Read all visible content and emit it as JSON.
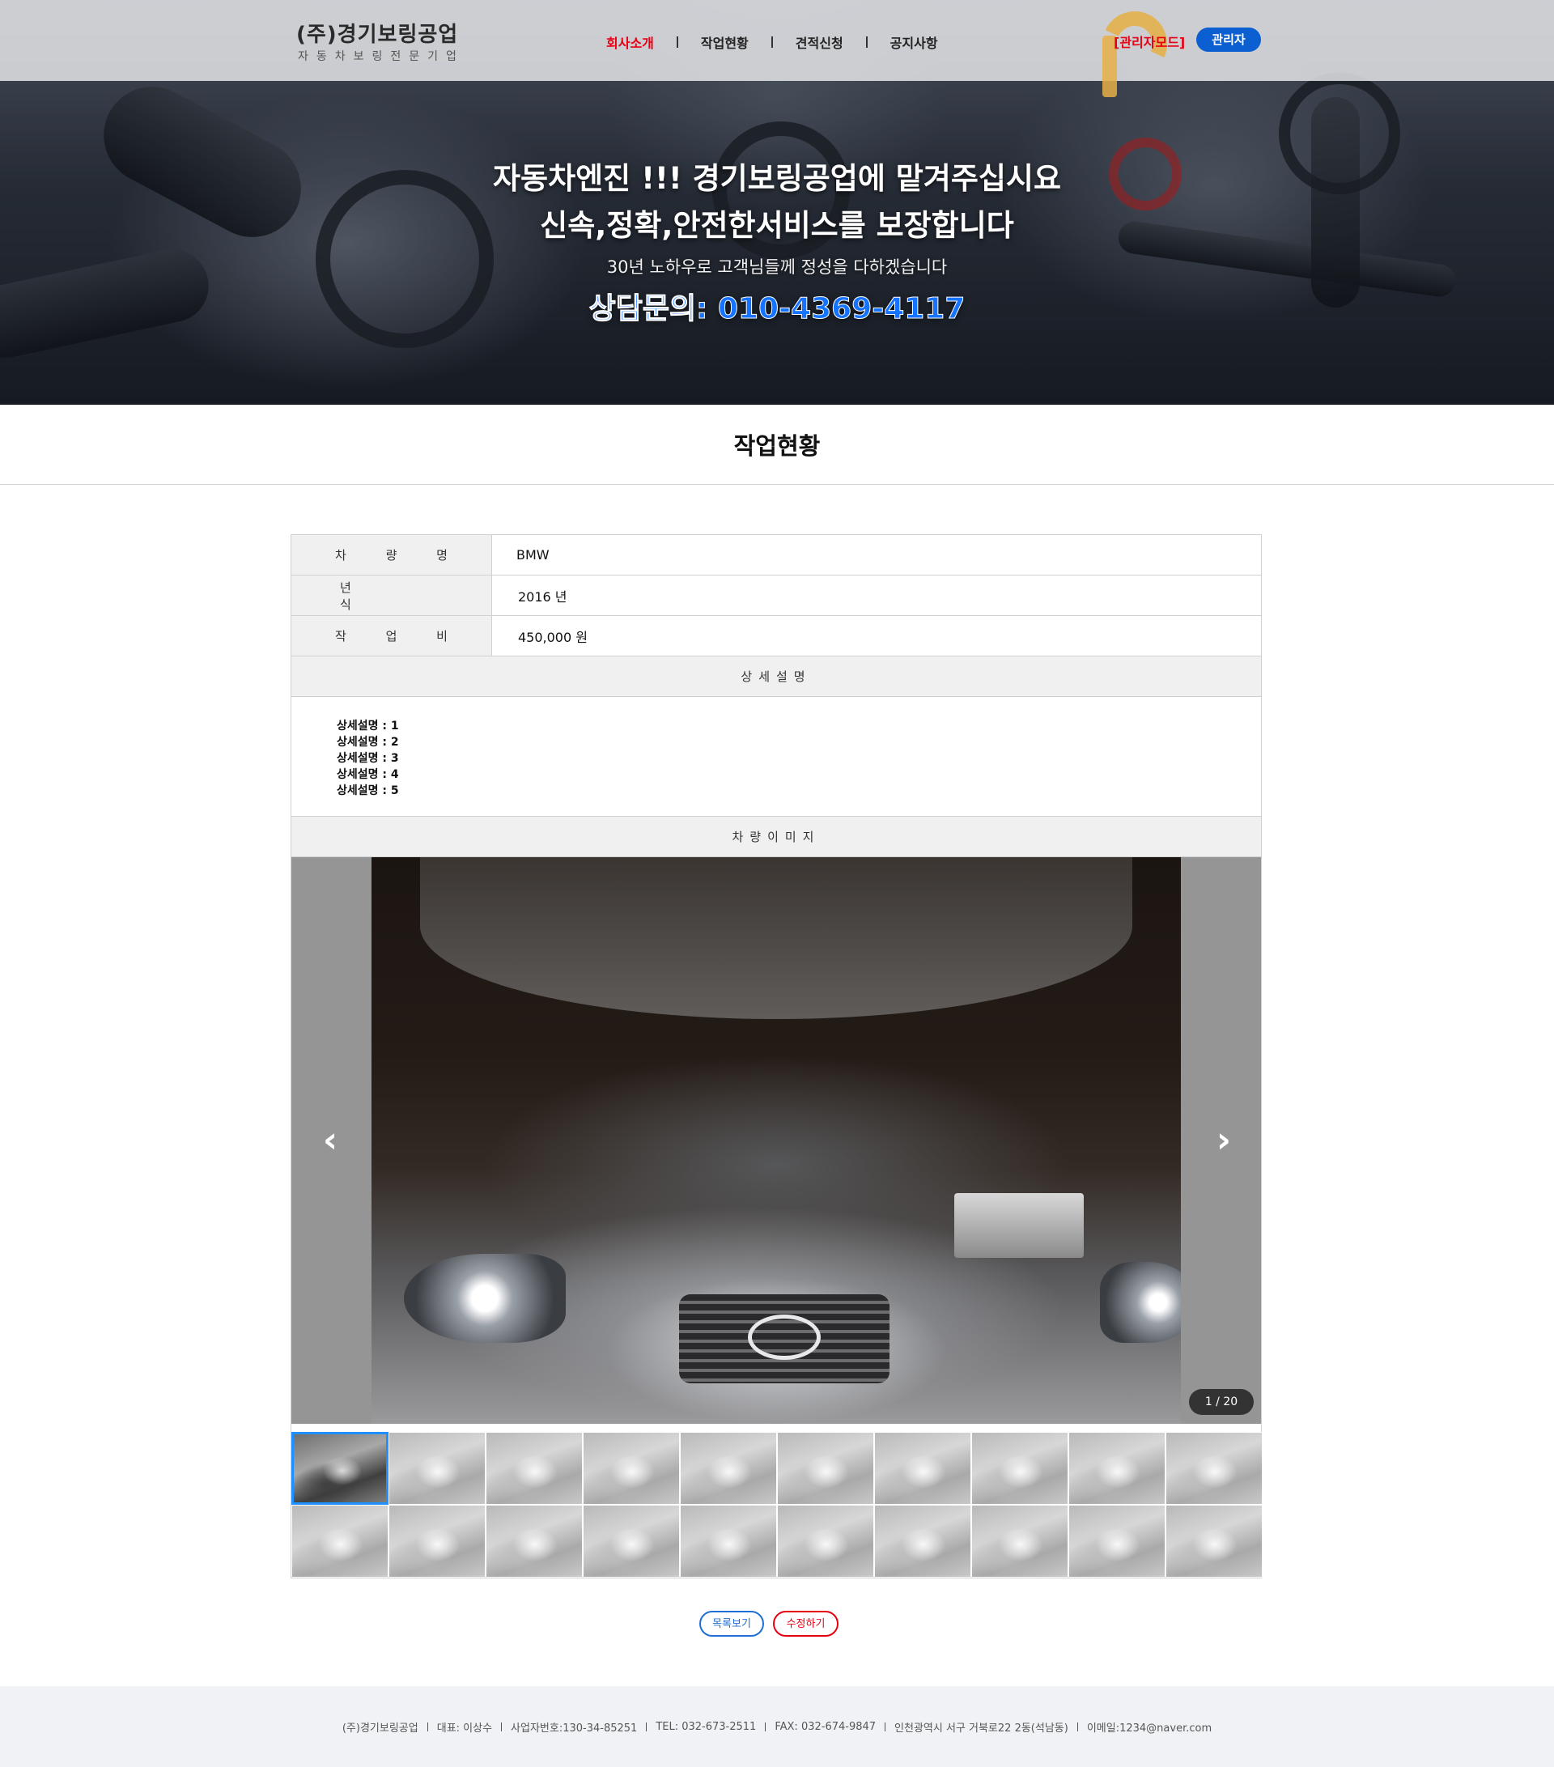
{
  "header": {
    "logo_title": "(주)경기보링공업",
    "logo_sub": "자동차보링전문기업",
    "nav": [
      "회사소개",
      "작업현황",
      "견적신청",
      "공지사항"
    ],
    "admin_mode": "[관리자모드]",
    "admin_button": "관리자"
  },
  "hero": {
    "line1": "자동차엔진 !!! 경기보링공업에 맡겨주십시요",
    "line2": "신속,정확,안전한서비스를 보장합니다",
    "line3": "30년 노하우로 고객님들께 정성을 다하겠습니다",
    "line4": "상담문의: 010-4369-4117"
  },
  "page_title": "작업현황",
  "info": {
    "car_label": "차 량 명",
    "car_value": "BMW",
    "year_label": "년 식",
    "year_value": "2016 년",
    "cost_label": "작 업 비",
    "cost_value": "450,000 원",
    "desc_header": "상세설명",
    "desc_lines": [
      "상세설명 : 1",
      "상세설명 : 2",
      "상세설명 : 3",
      "상세설명 : 4",
      "상세설명 : 5"
    ],
    "image_header": "차량이미지"
  },
  "slider": {
    "prev_icon": "chevron-left-icon",
    "next_icon": "chevron-right-icon",
    "counter": "1 / 20",
    "thumb_count": 20,
    "active_thumb": 1
  },
  "buttons": {
    "list": "목록보기",
    "edit": "수정하기"
  },
  "footer": [
    "(주)경기보링공업",
    "대표: 이상수",
    "사업자번호:130-34-85251",
    "TEL: 032-673-2511",
    "FAX: 032-674-9847",
    "인천광역시 서구 거북로22 2동(석남동)",
    "이메일:1234@naver.com"
  ],
  "colors": {
    "accent_red": "#e60012",
    "accent_blue": "#0b5fd0",
    "phone_blue": "#1673ff"
  }
}
